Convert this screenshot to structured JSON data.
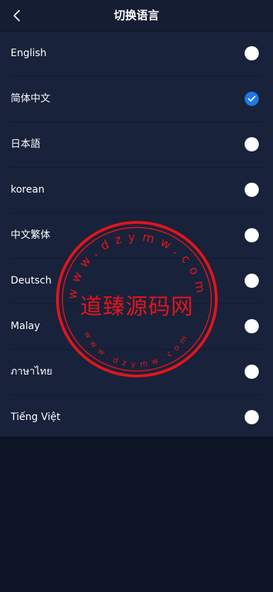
{
  "header": {
    "title": "切换语言"
  },
  "languages": [
    {
      "label": "English",
      "selected": false
    },
    {
      "label": "简体中文",
      "selected": true
    },
    {
      "label": "日本語",
      "selected": false
    },
    {
      "label": "korean",
      "selected": false
    },
    {
      "label": "中文繁体",
      "selected": false
    },
    {
      "label": "Deutsch",
      "selected": false
    },
    {
      "label": "Malay",
      "selected": false
    },
    {
      "label": "ภาษาไทย",
      "selected": false
    },
    {
      "label": "Tiếng Việt",
      "selected": false
    }
  ],
  "watermark": {
    "center_text": "道臻源码网",
    "ring_text": "www.dzymw.com",
    "color": "#e3141b"
  },
  "colors": {
    "accent": "#1e78e6",
    "panel": "#18223a",
    "background": "#0d1526"
  }
}
